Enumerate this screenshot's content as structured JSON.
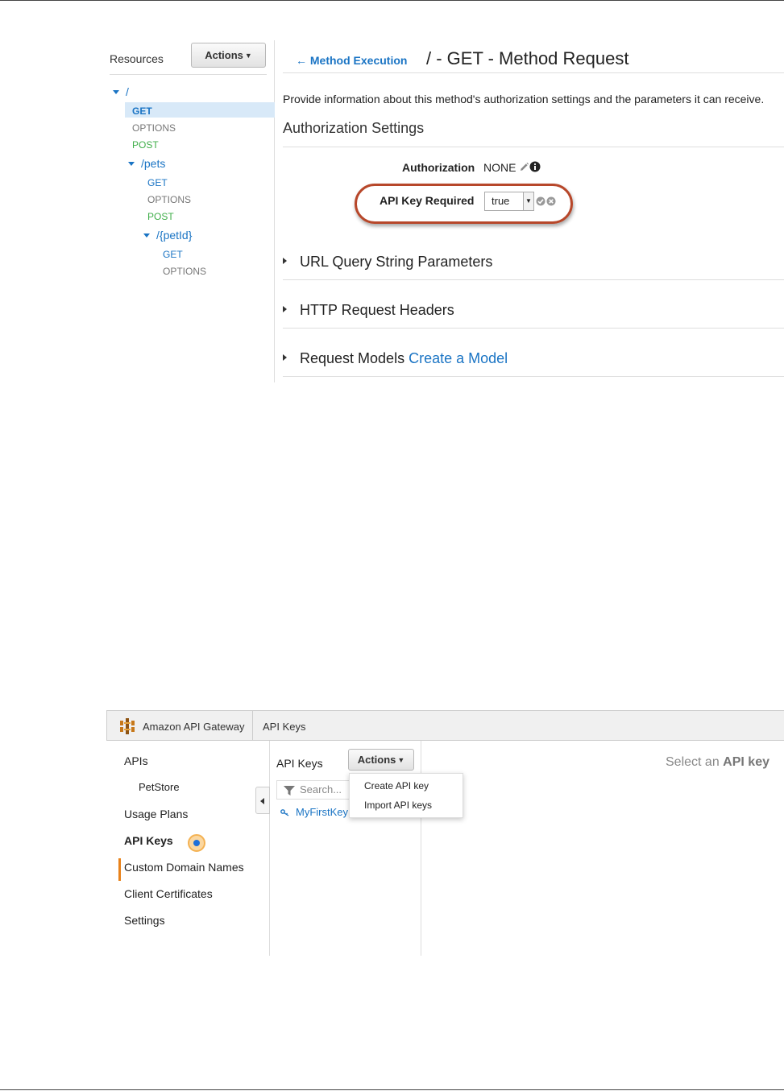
{
  "method_request_screen": {
    "resources": {
      "title": "Resources",
      "actions_label": "Actions",
      "tree": [
        {
          "label": "/"
        },
        {
          "label": "GET"
        },
        {
          "label": "OPTIONS"
        },
        {
          "label": "POST"
        },
        {
          "label": "/pets"
        },
        {
          "label": "GET"
        },
        {
          "label": "OPTIONS"
        },
        {
          "label": "POST"
        },
        {
          "label": "/{petId}"
        },
        {
          "label": "GET"
        },
        {
          "label": "OPTIONS"
        }
      ]
    },
    "header": {
      "back_link": "Method Execution",
      "title": "/ - GET - Method Request"
    },
    "description": "Provide information about this method's authorization settings and the parameters it can receive.",
    "authorization_settings": {
      "title": "Authorization Settings",
      "authorization_label": "Authorization",
      "authorization_value": "NONE",
      "api_key_label": "API Key Required",
      "api_key_value": "true"
    },
    "sections": {
      "query": "URL Query String Parameters",
      "headers": "HTTP Request Headers",
      "models": "Request Models",
      "models_link": "Create a Model"
    },
    "colors": {
      "link_blue": "#1a74c4",
      "post_green": "#3fae49",
      "highlight_red": "#b7472a"
    }
  },
  "api_keys_screen": {
    "topbar": {
      "app_title": "Amazon API Gateway",
      "breadcrumb": "API Keys"
    },
    "nav": {
      "apis": "APIs",
      "petstore": "PetStore",
      "usage_plans": "Usage Plans",
      "api_keys": "API Keys",
      "custom_domains": "Custom Domain Names",
      "client_certificates": "Client Certificates",
      "settings": "Settings"
    },
    "keys_panel": {
      "title": "API Keys",
      "actions_label": "Actions",
      "search_placeholder": "Search...",
      "key_name": "MyFirstKey"
    },
    "actions_menu": {
      "create": "Create API key",
      "import": "Import API keys"
    },
    "empty_prompt": {
      "prefix": "Select an",
      "bold": "API key"
    },
    "colors": {
      "active_orange": "#e8821b"
    }
  }
}
